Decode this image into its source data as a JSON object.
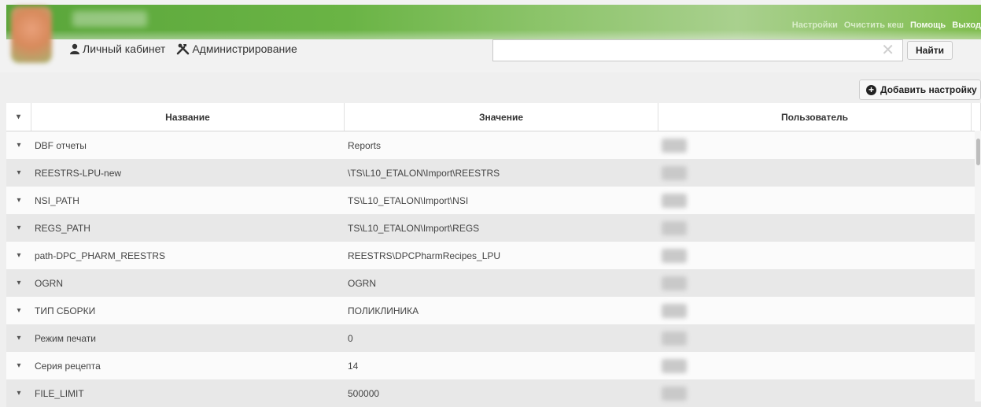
{
  "header": {
    "links": [
      "Настройки",
      "Очистить кеш",
      "Помощь",
      "Выход"
    ],
    "nav": {
      "cabinet_label": "Личный кабинет",
      "admin_label": "Администрирование"
    },
    "search": {
      "value": "",
      "placeholder": ""
    },
    "find_label": "Найти"
  },
  "toolbar": {
    "add_setting_label": "Добавить настройку"
  },
  "table": {
    "columns": [
      "Название",
      "Значение",
      "Пользователь"
    ],
    "rows": [
      {
        "name": "DBF отчеты",
        "value": "Reports"
      },
      {
        "name": "REESTRS-LPU-new",
        "value": "\\TS\\L10_ETALON\\Import\\REESTRS"
      },
      {
        "name": "NSI_PATH",
        "value": "TS\\L10_ETALON\\Import\\NSI"
      },
      {
        "name": "REGS_PATH",
        "value": "TS\\L10_ETALON\\Import\\REGS"
      },
      {
        "name": "path-DPC_PHARM_REESTRS",
        "value": "REESTRS\\DPCPharmRecipes_LPU"
      },
      {
        "name": "OGRN",
        "value": "OGRN"
      },
      {
        "name": "ТИП СБОРКИ",
        "value": "ПОЛИКЛИНИКА"
      },
      {
        "name": "Режим печати",
        "value": "0"
      },
      {
        "name": "Серия рецепта",
        "value": "14"
      },
      {
        "name": "FILE_LIMIT",
        "value": "500000"
      }
    ]
  },
  "icons": {
    "user": "user-icon",
    "tools": "tools-icon",
    "clear": "clear-icon",
    "plus": "plus-circle-icon",
    "row_toggle": "chevron-down-icon"
  },
  "colors": {
    "brand_green": "#6ab445"
  }
}
